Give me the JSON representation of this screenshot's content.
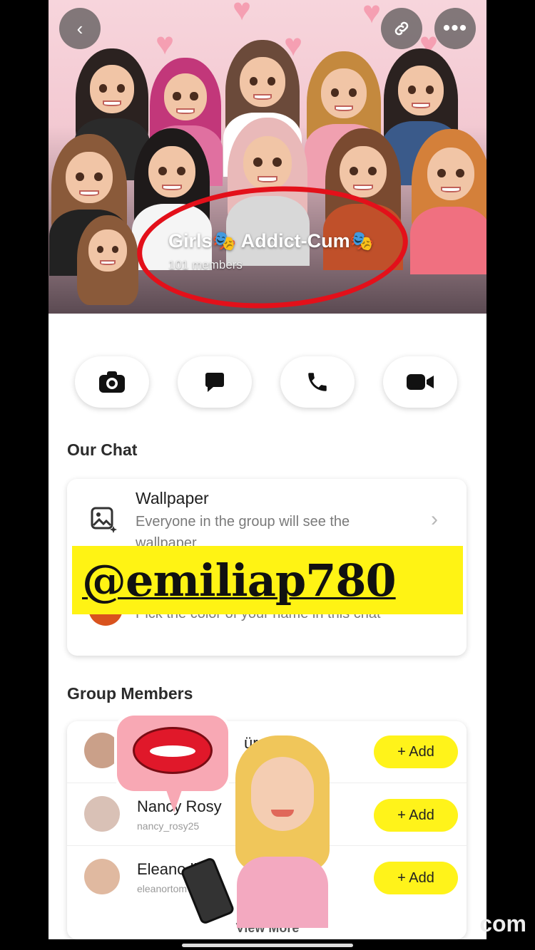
{
  "header": {
    "group_name": "Girls🎭 Addict-Cum🎭",
    "member_count": "101 members",
    "back_icon": "back-chevron-icon",
    "link_icon": "link-icon",
    "more_icon": "more-dots-icon"
  },
  "actions": [
    {
      "name": "camera",
      "icon": "camera-icon"
    },
    {
      "name": "chat",
      "icon": "chat-bubble-icon"
    },
    {
      "name": "call",
      "icon": "phone-icon"
    },
    {
      "name": "video",
      "icon": "video-camera-icon"
    }
  ],
  "our_chat": {
    "title": "Our Chat",
    "wallpaper": {
      "title": "Wallpaper",
      "subtitle": "Everyone in the group will see the wallpaper",
      "icon": "wallpaper-icon"
    },
    "name_color": {
      "subtitle": "Pick the color of your name in this chat"
    }
  },
  "overlay": {
    "promo_text": "@emiliap780",
    "promo_color": "#fff314",
    "watermark_text": "com"
  },
  "group_members": {
    "title": "Group Members",
    "add_label": "+ Add",
    "members": [
      {
        "name": "ürg",
        "handle": ""
      },
      {
        "name": "Nancy Rosy",
        "handle": "nancy_rosy25"
      },
      {
        "name": "Eleano lir",
        "handle": "eleanortom"
      }
    ],
    "view_more": "View More"
  },
  "colors": {
    "accent_yellow": "#fff31a",
    "circle_red": "#e3101a"
  }
}
